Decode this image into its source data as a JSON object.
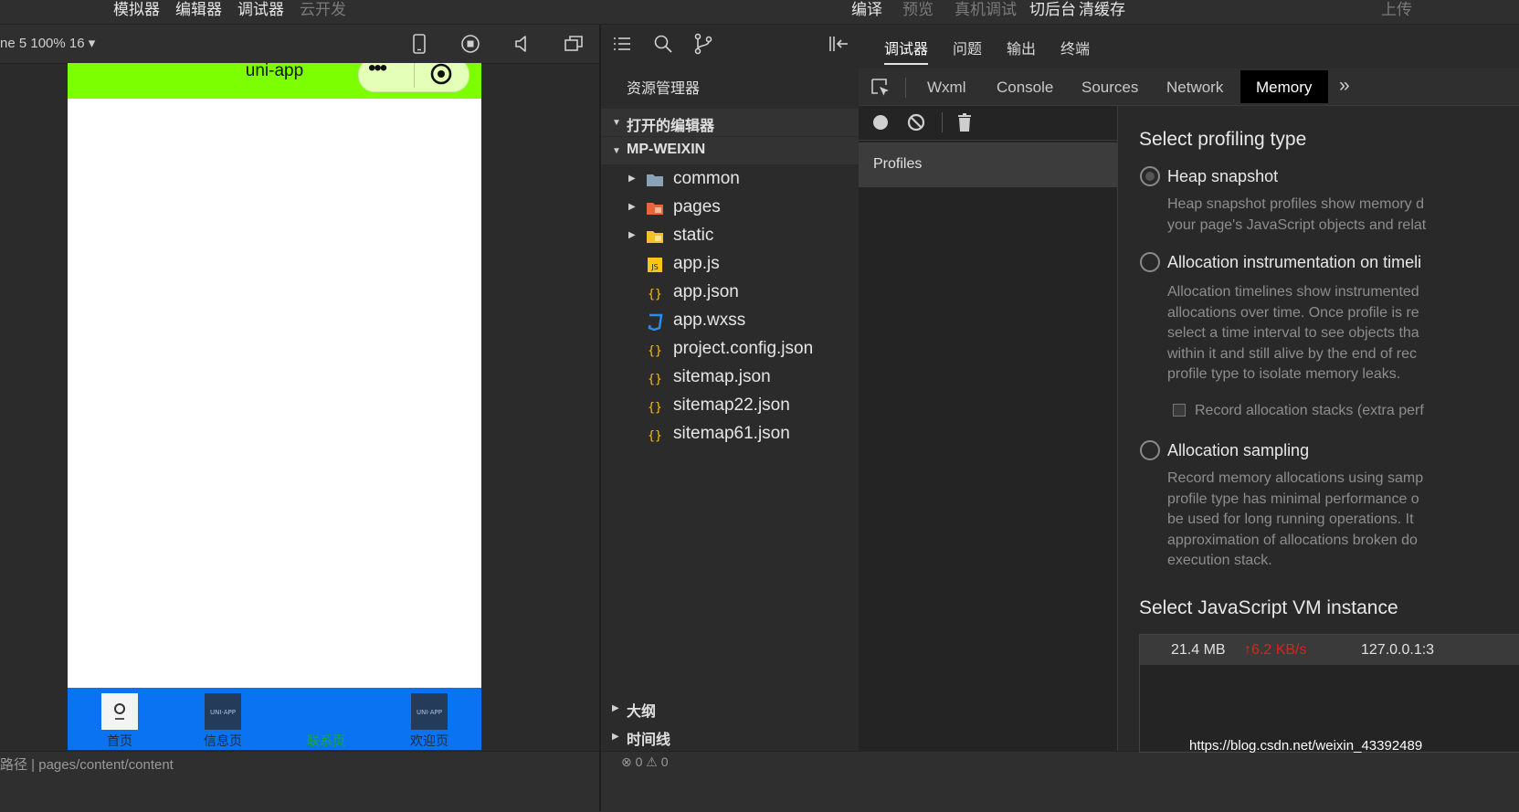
{
  "menubar": {
    "left": [
      "模拟器",
      "编辑器",
      "调试器",
      "云开发"
    ],
    "right": [
      "编译",
      "预览",
      "真机调试",
      "切后台",
      "清缓存"
    ],
    "upload": "上传"
  },
  "simulator": {
    "device_label": "ne 5 100% 16 ▾",
    "phone": {
      "nav_title": "uni-app",
      "capsule_dots": "•••",
      "tabs": [
        {
          "label": "首页",
          "color": "#1f2b3d"
        },
        {
          "label": "信息页",
          "color": "#1f2b3d"
        },
        {
          "label": "联系页",
          "color": "#1aad19"
        },
        {
          "label": "欢迎页",
          "color": "#1f2b3d"
        }
      ]
    },
    "status_path": "路径   |  pages/content/content"
  },
  "explorer": {
    "title": "资源管理器",
    "sections": {
      "open_editors": "打开的编辑器",
      "project": "MP-WEIXIN",
      "outline": "大纲",
      "timeline": "时间线"
    },
    "files": [
      {
        "name": "common",
        "type": "folder"
      },
      {
        "name": "pages",
        "type": "folder-pages"
      },
      {
        "name": "static",
        "type": "folder-static"
      },
      {
        "name": "app.js",
        "type": "js"
      },
      {
        "name": "app.json",
        "type": "json"
      },
      {
        "name": "app.wxss",
        "type": "css"
      },
      {
        "name": "project.config.json",
        "type": "json"
      },
      {
        "name": "sitemap.json",
        "type": "json"
      },
      {
        "name": "sitemap22.json",
        "type": "json"
      },
      {
        "name": "sitemap61.json",
        "type": "json"
      }
    ],
    "status": "⊗ 0  ⚠ 0"
  },
  "devtools": {
    "top_tabs": [
      "调试器",
      "问题",
      "输出",
      "终端"
    ],
    "panel_tabs": [
      "Wxml",
      "Console",
      "Sources",
      "Network",
      "Memory"
    ],
    "active_panel": "Memory",
    "more": "»",
    "sidebar": {
      "profiles": "Profiles"
    },
    "memory": {
      "select_type_heading": "Select profiling type",
      "options": [
        {
          "title": "Heap snapshot",
          "selected": true,
          "desc": [
            "Heap snapshot profiles show memory d",
            "your page's JavaScript objects and relat"
          ]
        },
        {
          "title": "Allocation instrumentation on timeli",
          "selected": false,
          "desc": [
            "Allocation timelines show instrumented",
            "allocations over time. Once profile is re",
            "select a time interval to see objects tha",
            "within it and still alive by the end of rec",
            "profile type to isolate memory leaks."
          ]
        },
        {
          "title": "Allocation sampling",
          "selected": false,
          "desc": [
            "Record memory allocations using samp",
            "profile type has minimal performance o",
            "be used for long running operations. It",
            "approximation of allocations broken do",
            "execution stack."
          ]
        }
      ],
      "record_stacks_label": "Record allocation stacks (extra perf",
      "vm_heading": "Select JavaScript VM instance",
      "vm_row": {
        "memory": "21.4 MB",
        "rate": "↑6.2 KB/s",
        "host": "127.0.0.1:3"
      }
    }
  },
  "watermark": "https://blog.csdn.net/weixin_43392489"
}
